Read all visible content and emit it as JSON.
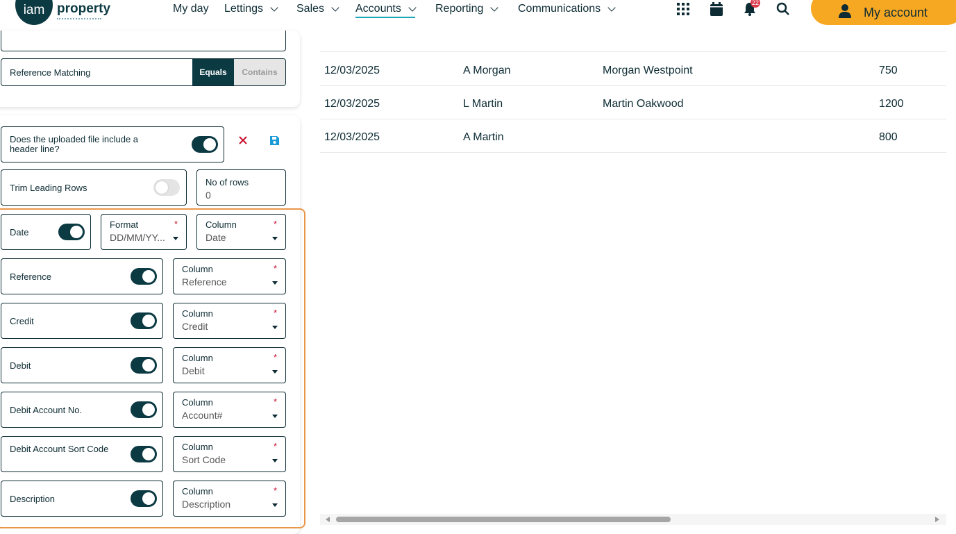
{
  "brand": {
    "logo_a": "iam",
    "logo_b": "property"
  },
  "nav": {
    "items": [
      {
        "label": "My day"
      },
      {
        "label": "Lettings"
      },
      {
        "label": "Sales"
      },
      {
        "label": "Accounts"
      },
      {
        "label": "Reporting"
      },
      {
        "label": "Communications"
      }
    ],
    "active": "Accounts",
    "notifications_count": "22",
    "my_account_label": "My account"
  },
  "settings": {
    "reference_matching": {
      "label": "Reference Matching",
      "options": [
        "Equals",
        "Contains"
      ],
      "selected": "Equals"
    },
    "header_line": {
      "label": "Does the uploaded file include a header line?",
      "enabled": true
    },
    "trim_leading_rows": {
      "label": "Trim Leading Rows",
      "enabled": false
    },
    "no_of_rows": {
      "label": "No of rows",
      "value": "0"
    },
    "date": {
      "label": "Date",
      "enabled": true,
      "format_title": "Format",
      "format_value": "DD/MM/YY...",
      "column_title": "Column",
      "column_value": "Date"
    }
  },
  "mappings": [
    {
      "label": "Reference",
      "enabled": true,
      "column_title": "Column",
      "column_value": "Reference"
    },
    {
      "label": "Credit",
      "enabled": true,
      "column_title": "Column",
      "column_value": "Credit"
    },
    {
      "label": "Debit",
      "enabled": true,
      "column_title": "Column",
      "column_value": "Debit"
    },
    {
      "label": "Debit Account No.",
      "enabled": true,
      "column_title": "Column",
      "column_value": "Account#"
    },
    {
      "label": "Debit Account Sort Code",
      "enabled": true,
      "column_title": "Column",
      "column_value": "Sort Code"
    },
    {
      "label": "Description",
      "enabled": true,
      "column_title": "Column",
      "column_value": "Description"
    }
  ],
  "required_marker": "*",
  "table": {
    "rows": [
      {
        "date": "12/03/2025",
        "name": "A Morgan",
        "reference": "Morgan Westpoint",
        "amount": "750"
      },
      {
        "date": "12/03/2025",
        "name": "L Martin",
        "reference": "Martin Oakwood",
        "amount": "1200"
      },
      {
        "date": "12/03/2025",
        "name": "A Martin",
        "reference": "",
        "amount": "800"
      }
    ]
  },
  "colors": {
    "primary": "#0c3a43",
    "accent": "#f7a823",
    "highlight": "#e8964a",
    "danger": "#c8102e",
    "save": "#1a9bd7"
  },
  "icons": [
    "apps-grid-icon",
    "calendar-icon",
    "bell-icon",
    "search-icon",
    "user-icon",
    "close-icon",
    "save-icon"
  ]
}
